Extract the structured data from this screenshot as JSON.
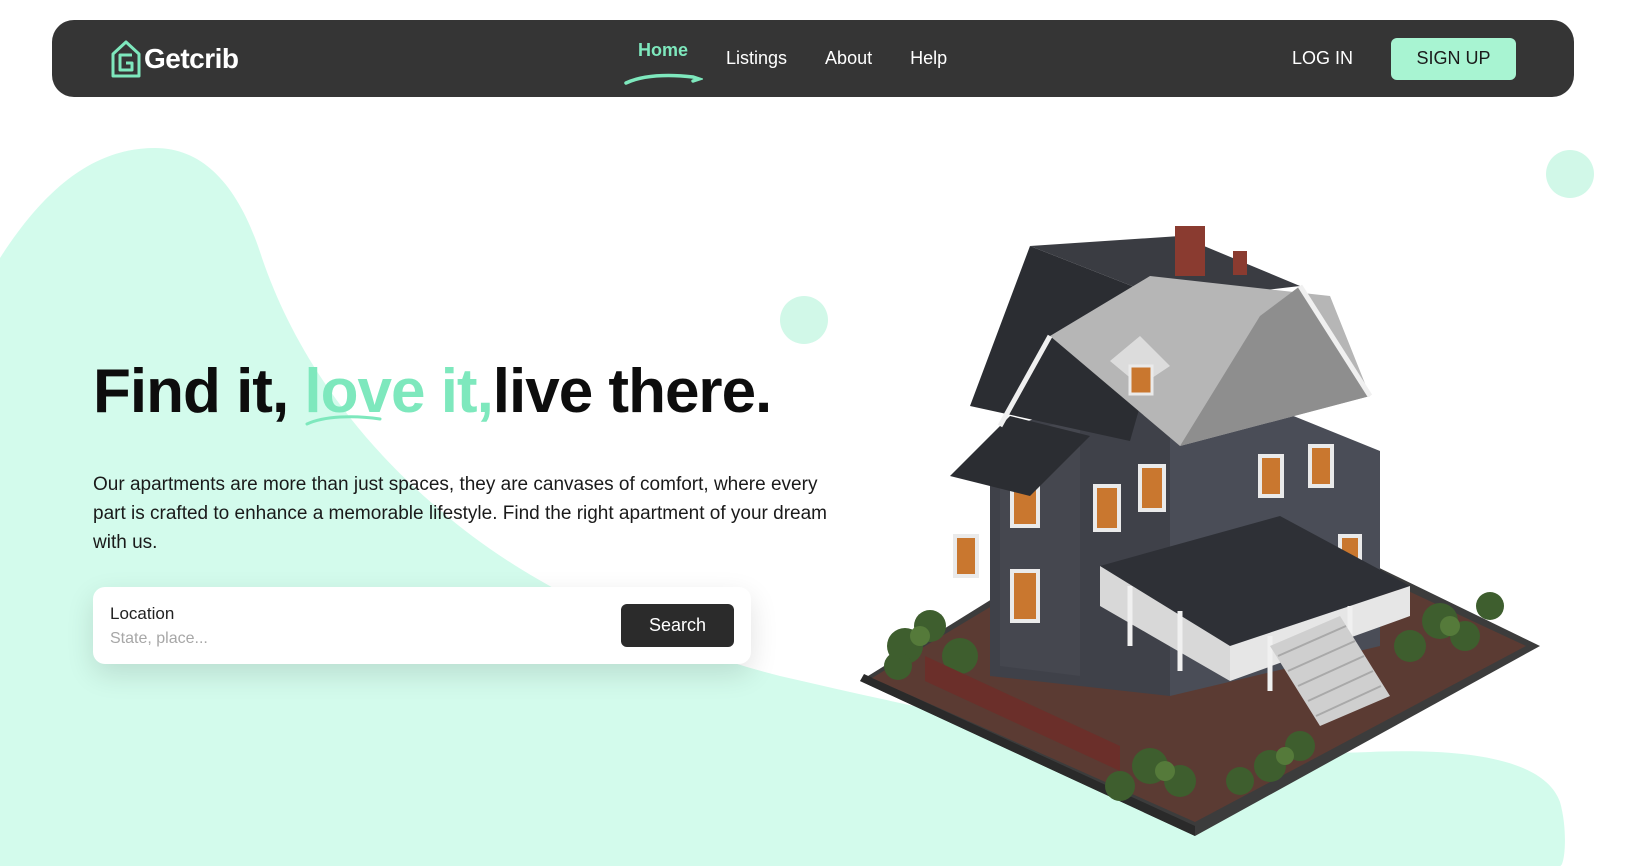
{
  "colors": {
    "accent": "#7ee8bd",
    "blob": "#d3fbec",
    "dot": "#d1f8e8",
    "nav_bg": "#353535",
    "signup_bg": "#a8f4d2",
    "search_button_bg": "#2b2b2b"
  },
  "logo": {
    "text": "Getcrib",
    "icon": "house-g-logo-icon"
  },
  "nav": {
    "links": [
      {
        "label": "Home",
        "active": true
      },
      {
        "label": "Listings",
        "active": false
      },
      {
        "label": "About",
        "active": false
      },
      {
        "label": "Help",
        "active": false
      }
    ],
    "login_label": "LOG IN",
    "signup_label": "SIGN UP"
  },
  "hero": {
    "title_part1": "Find it,",
    "title_accent": "love it,",
    "title_part2": "live there.",
    "description": "Our apartments are more than just spaces, they are canvases of comfort, where every part is crafted to enhance a memorable lifestyle. Find the right apartment of your dream with us.",
    "image": "victorian-house-illustration"
  },
  "search": {
    "label": "Location",
    "placeholder": "State, place...",
    "value": "",
    "button_label": "Search"
  }
}
